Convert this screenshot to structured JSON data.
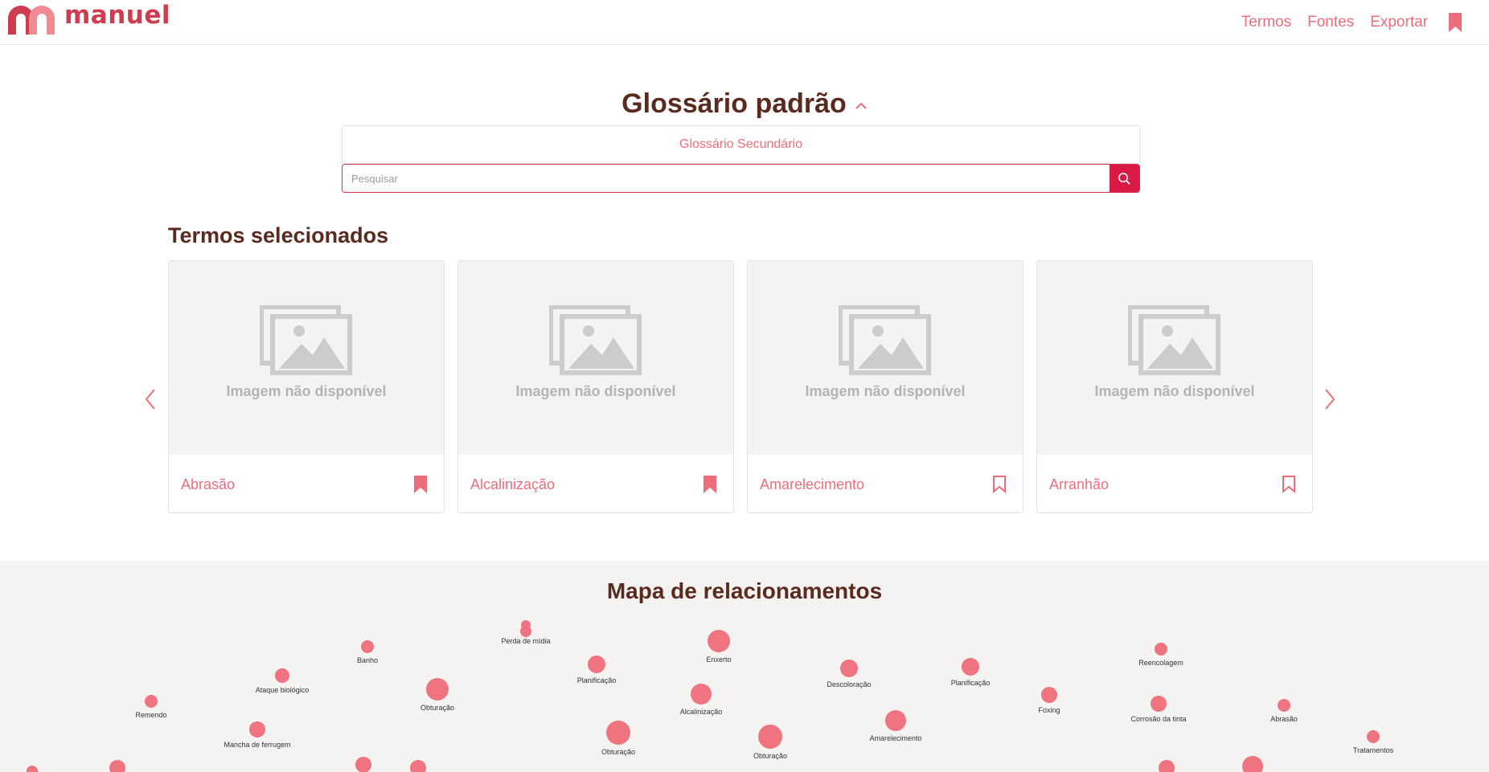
{
  "brand": {
    "name": "manuel"
  },
  "nav": {
    "items": [
      "Termos",
      "Fontes",
      "Exportar"
    ],
    "bookmark_icon": "bookmark-icon"
  },
  "glossary": {
    "title": "Glossário padrão",
    "option": "Glossário Secundário"
  },
  "search": {
    "placeholder": "Pesquisar",
    "icon": "search-icon"
  },
  "selected": {
    "title": "Termos selecionados",
    "no_image_label": "Imagem não disponível",
    "cards": [
      {
        "name": "Abrasão",
        "bookmarked": true
      },
      {
        "name": "Alcalinização",
        "bookmarked": true
      },
      {
        "name": "Amarelecimento",
        "bookmarked": false
      },
      {
        "name": "Arranhão",
        "bookmarked": false
      }
    ]
  },
  "map": {
    "title": "Mapa de relacionamentos",
    "nodes": [
      {
        "label": "Perda de mídia"
      },
      {
        "label": "Enxerto"
      },
      {
        "label": "Banho"
      },
      {
        "label": "Planificação"
      },
      {
        "label": "Descoloração"
      },
      {
        "label": "Planificação"
      },
      {
        "label": "Reencolagem"
      },
      {
        "label": "Ataque biológico"
      },
      {
        "label": "Obturação"
      },
      {
        "label": "Alcalinização"
      },
      {
        "label": "Foxing"
      },
      {
        "label": "Remendo"
      },
      {
        "label": "Corrosão da tinta"
      },
      {
        "label": "Abrasão"
      },
      {
        "label": "Amarelecimento"
      },
      {
        "label": "Mancha de ferrugem"
      },
      {
        "label": "Obturação"
      },
      {
        "label": "Obturação"
      },
      {
        "label": "Tratamentos"
      }
    ]
  },
  "colors": {
    "accent": "#ec6e7d",
    "primary": "#d81a44",
    "heading": "#5b2a1f",
    "node": "#f07380"
  }
}
